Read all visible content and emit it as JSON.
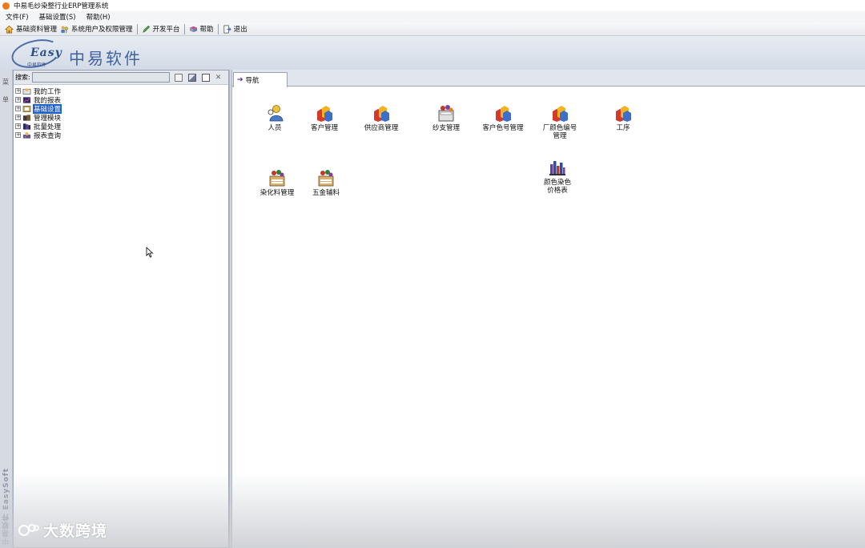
{
  "window": {
    "title": "中易毛纱染整行业ERP管理系统",
    "icon": "app-logo-icon"
  },
  "menubar": {
    "items": [
      {
        "label": "文件(F)"
      },
      {
        "label": "基础设置(S)"
      },
      {
        "label": "帮助(H)"
      }
    ]
  },
  "toolbar": {
    "items": [
      {
        "label": "基础资料管理",
        "icon": "house-icon"
      },
      {
        "label": "系统用户及权限管理",
        "icon": "users-key-icon"
      },
      {
        "label": "开发平台",
        "icon": "pencil-icon"
      },
      {
        "label": "帮助",
        "icon": "book-icon"
      },
      {
        "label": "退出",
        "icon": "door-exit-icon"
      }
    ]
  },
  "banner": {
    "logo_text": "Easy",
    "logo_sub": "中易软件",
    "brand_name": "中易软件"
  },
  "sidestrip": {
    "label_1": "菜",
    "label_2": "单",
    "brand": "中易软件 EasySoft"
  },
  "search": {
    "label": "搜索:",
    "value": "",
    "placeholder": ""
  },
  "tree": {
    "items": [
      {
        "label": "我的工作",
        "icon": "work-icon",
        "selected": false
      },
      {
        "label": "我的报表",
        "icon": "report-chart-icon",
        "selected": false
      },
      {
        "label": "基础设置",
        "icon": "settings-icon",
        "selected": true
      },
      {
        "label": "管理模块",
        "icon": "module-icon",
        "selected": false
      },
      {
        "label": "批量处理",
        "icon": "batch-icon",
        "selected": false
      },
      {
        "label": "报表查询",
        "icon": "query-icon",
        "selected": false
      }
    ]
  },
  "tabs": [
    {
      "label": "导航",
      "active": true
    }
  ],
  "nav": {
    "items": [
      {
        "label": "人员",
        "icon": "person-icon"
      },
      {
        "label": "客户管理",
        "icon": "blocks-icon"
      },
      {
        "label": "供应商管理",
        "icon": "blocks-icon"
      },
      {
        "label": "纱支管理",
        "icon": "yarn-icon"
      },
      {
        "label": "客户色号管理",
        "icon": "blocks-icon"
      },
      {
        "label": "厂颜色编号管理",
        "icon": "blocks-icon"
      },
      {
        "label": "工序",
        "icon": "blocks-icon"
      },
      {
        "label": "染化料管理",
        "icon": "dye-icon"
      },
      {
        "label": "五金辅料",
        "icon": "dye-icon"
      },
      {
        "label": "颜色染色价格表",
        "icon": "bar-chart-icon"
      }
    ]
  },
  "watermark": {
    "text": "大数跨境"
  },
  "colors": {
    "selection": "#1f5ec4",
    "brand_blue": "#3e63a0",
    "logo_orange": "#e47c1c"
  }
}
